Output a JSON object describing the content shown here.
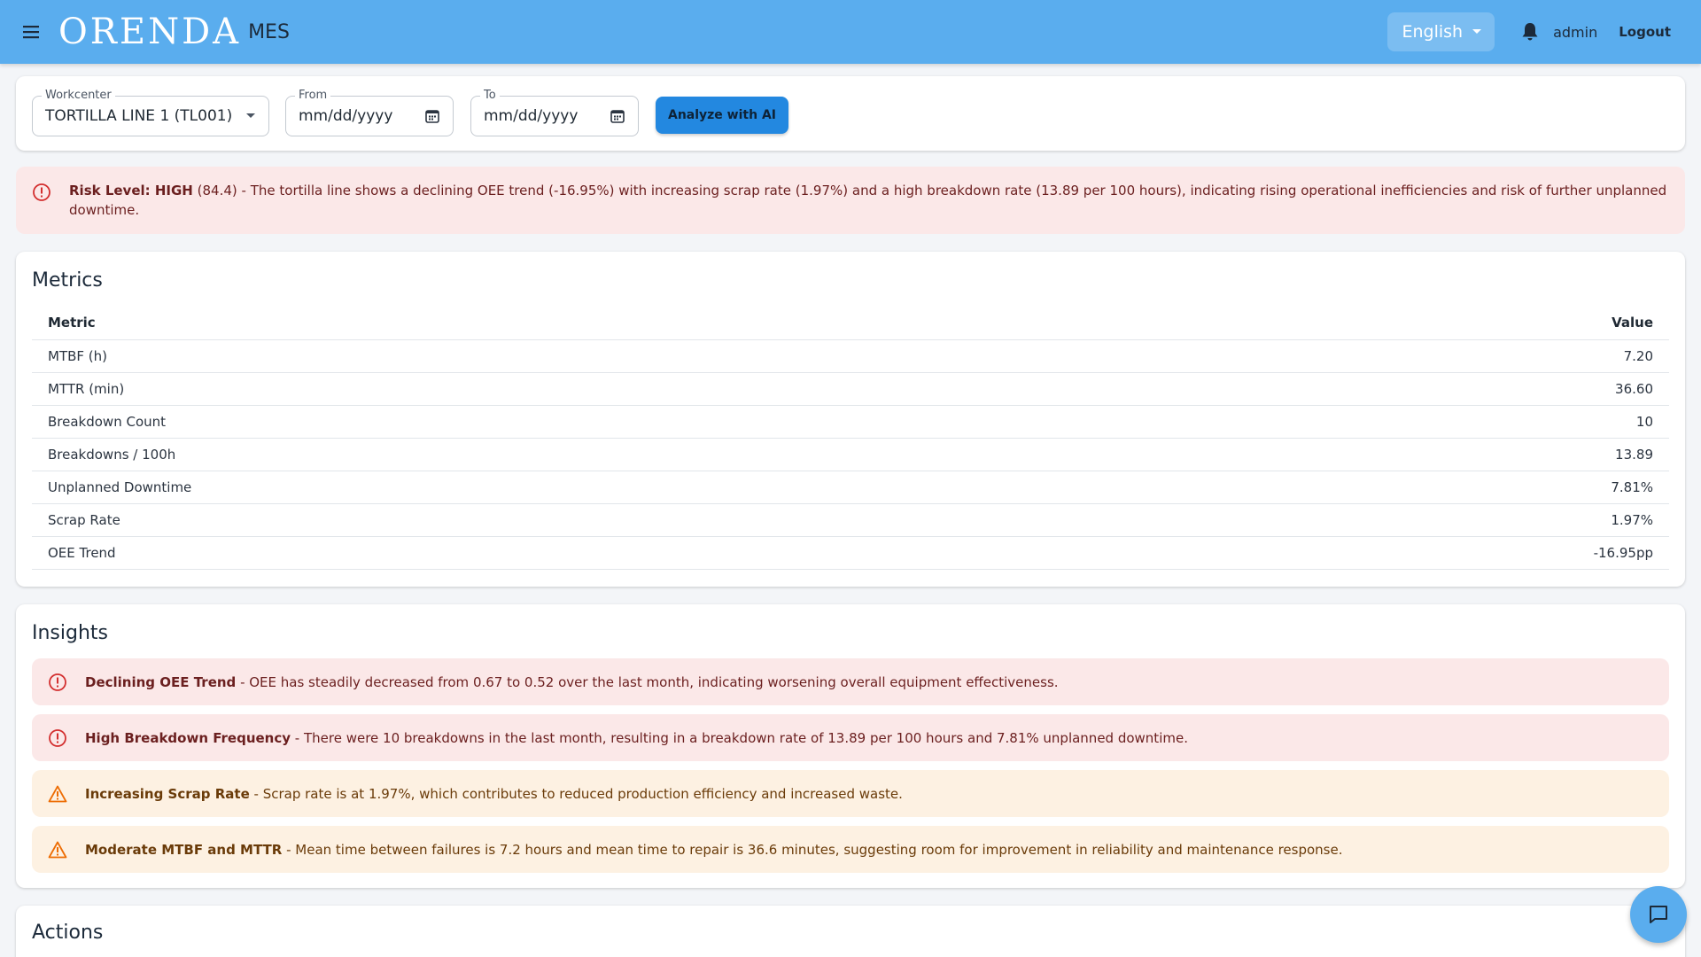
{
  "header": {
    "logo": "ORENDA",
    "app_name": "MES",
    "language": "English",
    "user": "admin",
    "logout_label": "Logout"
  },
  "filters": {
    "workcenter_label": "Workcenter",
    "workcenter_value": "TORTILLA LINE 1 (TL001)",
    "from_label": "From",
    "from_value": "mm/dd/yyyy",
    "to_label": "To",
    "to_value": "mm/dd/yyyy",
    "analyze_label": "Analyze with AI"
  },
  "risk": {
    "label": "Risk Level: HIGH",
    "score": "(84.4)",
    "text": " - The tortilla line shows a declining OEE trend (-16.95%) with increasing scrap rate (1.97%) and a high breakdown rate (13.89 per 100 hours), indicating rising operational inefficiencies and risk of further unplanned downtime."
  },
  "metrics": {
    "title": "Metrics",
    "col_metric": "Metric",
    "col_value": "Value",
    "rows": [
      {
        "name": "MTBF (h)",
        "value": "7.20"
      },
      {
        "name": "MTTR (min)",
        "value": "36.60"
      },
      {
        "name": "Breakdown Count",
        "value": "10"
      },
      {
        "name": "Breakdowns / 100h",
        "value": "13.89"
      },
      {
        "name": "Unplanned Downtime",
        "value": "7.81%"
      },
      {
        "name": "Scrap Rate",
        "value": "1.97%"
      },
      {
        "name": "OEE Trend",
        "value": "-16.95pp"
      }
    ]
  },
  "insights": {
    "title": "Insights",
    "items": [
      {
        "severity": "error",
        "title": "Declining OEE Trend",
        "text": " - OEE has steadily decreased from 0.67 to 0.52 over the last month, indicating worsening overall equipment effectiveness."
      },
      {
        "severity": "error",
        "title": "High Breakdown Frequency",
        "text": " - There were 10 breakdowns in the last month, resulting in a breakdown rate of 13.89 per 100 hours and 7.81% unplanned downtime."
      },
      {
        "severity": "warning",
        "title": "Increasing Scrap Rate",
        "text": " - Scrap rate is at 1.97%, which contributes to reduced production efficiency and increased waste."
      },
      {
        "severity": "warning",
        "title": "Moderate MTBF and MTTR",
        "text": " - Mean time between failures is 7.2 hours and mean time to repair is 36.6 minutes, suggesting room for improvement in reliability and maintenance response."
      }
    ]
  },
  "actions": {
    "title": "Actions"
  },
  "colors": {
    "app_bar": "#5aadee",
    "primary_button": "#2388e0",
    "error_bg": "#fbe8e8",
    "error_icon": "#d32f2f",
    "warning_bg": "#fdf1e2",
    "warning_icon": "#ed6c02"
  },
  "icons": {
    "menu": "menu-icon",
    "language_dropdown": "chevron-down-icon",
    "notifications": "bell-icon",
    "calendar": "calendar-icon",
    "error": "error-circle-icon",
    "warning": "warning-triangle-icon",
    "chat": "chat-icon"
  }
}
